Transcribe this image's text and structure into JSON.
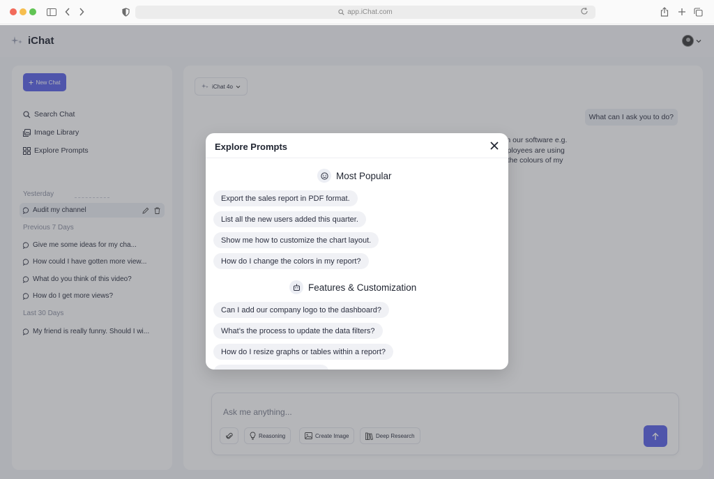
{
  "browser": {
    "url": "app.iChat.com"
  },
  "app": {
    "name": "iChat"
  },
  "sidebar": {
    "new_chat": "New Chat",
    "links": [
      {
        "label": "Search Chat",
        "icon": "search-icon"
      },
      {
        "label": "Image Library",
        "icon": "image-icon"
      },
      {
        "label": "Explore Prompts",
        "icon": "grid-icon"
      }
    ],
    "sections": [
      {
        "title": "Yesterday",
        "items": [
          "Audit my channel"
        ]
      },
      {
        "title": "Previous 7 Days",
        "items": [
          "Give me some ideas for my cha...",
          "How could I have gotten more view...",
          "What do you think of this video?",
          "How do I get more views?"
        ]
      },
      {
        "title": "Last 30 Days",
        "items": [
          "My friend is really funny. Should I wi..."
        ]
      }
    ]
  },
  "main": {
    "model": "iChat 4o",
    "user_message": "What can I ask you to do?",
    "bot_lines": [
      "ts in our software e.g.",
      "employees are using",
      "ge the colours of my"
    ]
  },
  "composer": {
    "placeholder": "Ask me anything...",
    "tools": [
      "Reasoning",
      "Create Image",
      "Deep Research"
    ]
  },
  "modal": {
    "title": "Explore Prompts",
    "categories": [
      {
        "title": "Most Popular",
        "icon": "smiley-icon",
        "prompts": [
          "Export the sales report in PDF format.",
          "List all the new users added this quarter.",
          "Show me how to customize the chart layout.",
          "How do I change the colors in my report?"
        ]
      },
      {
        "title": "Features & Customization",
        "icon": "robot-icon",
        "prompts": [
          "Can I add our company logo to the dashboard?",
          "What’s the process to update the data filters?",
          "How do I resize graphs or tables within a report?"
        ]
      }
    ]
  },
  "colors": {
    "accent": "#5b63e8",
    "overlay": "#3c3e48"
  }
}
